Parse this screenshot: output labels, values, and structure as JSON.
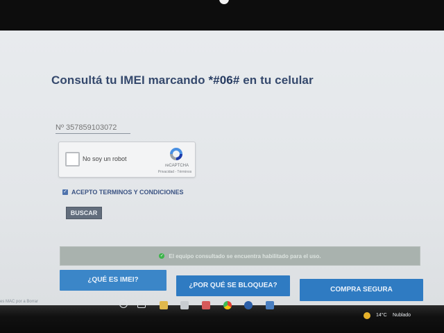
{
  "page": {
    "title_prefix": "Consultá tu IMEI marcando ",
    "title_code": "*#06#",
    "title_suffix": " en tu celular"
  },
  "form": {
    "imei_placeholder": "Nº 357859103072",
    "captcha": {
      "label": "No soy un robot",
      "brand": "reCAPTCHA",
      "links": "Privacidad - Términos"
    },
    "terms_label": "ACEPTO TERMINOS Y CONDICIONES",
    "terms_checked": true,
    "search_button": "BUSCAR"
  },
  "status": {
    "message": "El equipo consultado se encuentra habilitado para el uso."
  },
  "actions": {
    "que_es_imei": "¿QUÉ ES IMEI?",
    "por_que_bloquea": "¿POR QUÉ SE BLOQUEA?",
    "compra_segura": "COMPRA SEGURA"
  },
  "footer_note": "es MAC por a Borrar",
  "taskbar": {
    "weather_temp": "14°C",
    "weather_desc": "Nublado"
  },
  "colors": {
    "title": "#34486c",
    "button_blue": "#2f7bc2",
    "status_bar": "#a9b2ae",
    "success_green": "#3cb44a"
  }
}
